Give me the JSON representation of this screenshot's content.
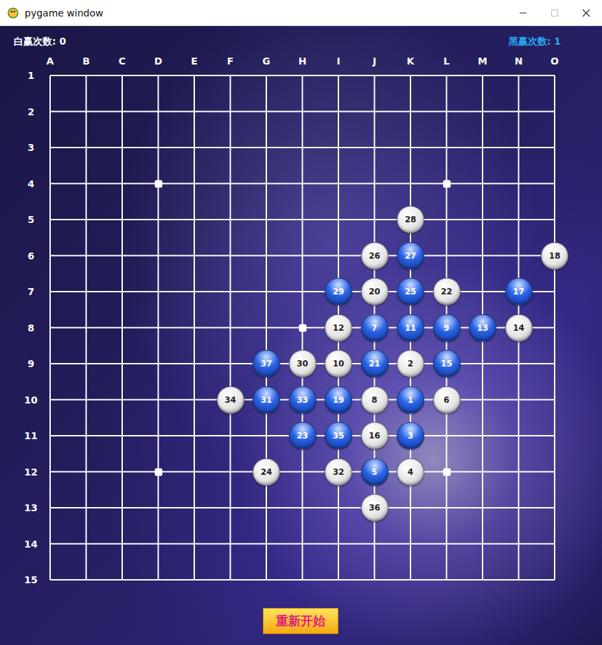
{
  "window": {
    "title": "pygame window"
  },
  "scores": {
    "white": "白赢次数: 0",
    "black": "黑赢次数: 1"
  },
  "board": {
    "columns": [
      "A",
      "B",
      "C",
      "D",
      "E",
      "F",
      "G",
      "H",
      "I",
      "J",
      "K",
      "L",
      "M",
      "N",
      "O"
    ],
    "rows": [
      "1",
      "2",
      "3",
      "4",
      "5",
      "6",
      "7",
      "8",
      "9",
      "10",
      "11",
      "12",
      "13",
      "14",
      "15"
    ],
    "star_points": [
      {
        "col": "D",
        "row": "4"
      },
      {
        "col": "L",
        "row": "4"
      },
      {
        "col": "H",
        "row": "8"
      },
      {
        "col": "D",
        "row": "12"
      },
      {
        "col": "L",
        "row": "12"
      }
    ]
  },
  "stones": [
    {
      "label": "1",
      "col": "K",
      "row": "10",
      "color": "#2a63e6"
    },
    {
      "label": "2",
      "col": "K",
      "row": "9",
      "color": "#e6e6e6"
    },
    {
      "label": "3",
      "col": "K",
      "row": "11",
      "color": "#2a63e6"
    },
    {
      "label": "4",
      "col": "K",
      "row": "12",
      "color": "#e6e6e6"
    },
    {
      "label": "5",
      "col": "J",
      "row": "12",
      "color": "#2a63e6"
    },
    {
      "label": "6",
      "col": "L",
      "row": "10",
      "color": "#e6e6e6"
    },
    {
      "label": "7",
      "col": "J",
      "row": "8",
      "color": "#2a63e6"
    },
    {
      "label": "8",
      "col": "J",
      "row": "10",
      "color": "#e6e6e6"
    },
    {
      "label": "9",
      "col": "L",
      "row": "8",
      "color": "#2a63e6"
    },
    {
      "label": "10",
      "col": "I",
      "row": "9",
      "color": "#e6e6e6"
    },
    {
      "label": "11",
      "col": "K",
      "row": "8",
      "color": "#2a63e6"
    },
    {
      "label": "12",
      "col": "I",
      "row": "8",
      "color": "#e6e6e6"
    },
    {
      "label": "13",
      "col": "M",
      "row": "8",
      "color": "#2a63e6"
    },
    {
      "label": "14",
      "col": "N",
      "row": "8",
      "color": "#e6e6e6"
    },
    {
      "label": "15",
      "col": "L",
      "row": "9",
      "color": "#2a63e6"
    },
    {
      "label": "16",
      "col": "J",
      "row": "11",
      "color": "#e6e6e6"
    },
    {
      "label": "17",
      "col": "N",
      "row": "7",
      "color": "#2a63e6"
    },
    {
      "label": "18",
      "col": "O",
      "row": "6",
      "color": "#e6e6e6"
    },
    {
      "label": "19",
      "col": "I",
      "row": "10",
      "color": "#2a63e6"
    },
    {
      "label": "20",
      "col": "J",
      "row": "7",
      "color": "#e6e6e6"
    },
    {
      "label": "21",
      "col": "J",
      "row": "9",
      "color": "#2a63e6"
    },
    {
      "label": "22",
      "col": "L",
      "row": "7",
      "color": "#e6e6e6"
    },
    {
      "label": "23",
      "col": "H",
      "row": "11",
      "color": "#2a63e6"
    },
    {
      "label": "24",
      "col": "G",
      "row": "12",
      "color": "#e6e6e6"
    },
    {
      "label": "25",
      "col": "K",
      "row": "7",
      "color": "#2a63e6"
    },
    {
      "label": "26",
      "col": "J",
      "row": "6",
      "color": "#e6e6e6"
    },
    {
      "label": "27",
      "col": "K",
      "row": "6",
      "color": "#2a63e6"
    },
    {
      "label": "28",
      "col": "K",
      "row": "5",
      "color": "#e6e6e6"
    },
    {
      "label": "29",
      "col": "I",
      "row": "7",
      "color": "#2a63e6"
    },
    {
      "label": "30",
      "col": "H",
      "row": "9",
      "color": "#e6e6e6"
    },
    {
      "label": "31",
      "col": "G",
      "row": "10",
      "color": "#2a63e6"
    },
    {
      "label": "32",
      "col": "I",
      "row": "12",
      "color": "#e6e6e6"
    },
    {
      "label": "33",
      "col": "H",
      "row": "10",
      "color": "#2a63e6"
    },
    {
      "label": "34",
      "col": "F",
      "row": "10",
      "color": "#e6e6e6"
    },
    {
      "label": "35",
      "col": "I",
      "row": "11",
      "color": "#2a63e6"
    },
    {
      "label": "36",
      "col": "J",
      "row": "13",
      "color": "#e6e6e6"
    },
    {
      "label": "37",
      "col": "G",
      "row": "9",
      "color": "#2a63e6"
    }
  ],
  "buttons": [
    "重新开始"
  ]
}
